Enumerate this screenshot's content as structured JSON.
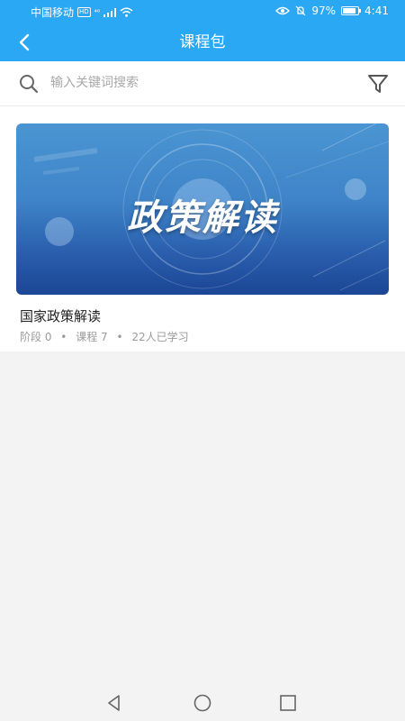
{
  "status_bar": {
    "carrier": "中国移动",
    "hd": "HD",
    "signal": "⁴⁶",
    "battery_percent": "97%",
    "time": "4:41"
  },
  "navbar": {
    "title": "课程包"
  },
  "search": {
    "placeholder": "输入关键词搜索"
  },
  "course": {
    "banner_text": "政策解读",
    "title": "国家政策解读",
    "stage_label": "阶段 0",
    "lessons_label": "课程 7",
    "learners_label": "22人已学习",
    "separator": "•"
  },
  "colors": {
    "brand": "#2aa8f4",
    "page_bg": "#f3f3f3"
  }
}
